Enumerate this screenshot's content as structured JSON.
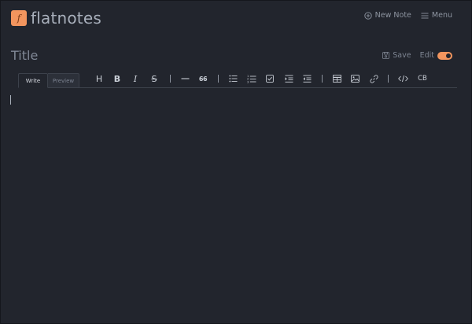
{
  "app": {
    "name": "flatnotes",
    "logo_glyph": "f"
  },
  "header": {
    "new_note_label": "New Note",
    "menu_label": "Menu"
  },
  "note": {
    "title": "Title",
    "save_label": "Save",
    "edit_label": "Edit",
    "edit_enabled": true
  },
  "editor": {
    "tabs": {
      "write": "Write",
      "preview": "Preview",
      "active": "Write"
    },
    "toolbar": {
      "heading": "H",
      "bold": "B",
      "italic": "I",
      "strike": "S",
      "quote": "66",
      "codeblock": "CB"
    },
    "content": ""
  },
  "colors": {
    "accent": "#f2955e",
    "background": "#22252d"
  }
}
